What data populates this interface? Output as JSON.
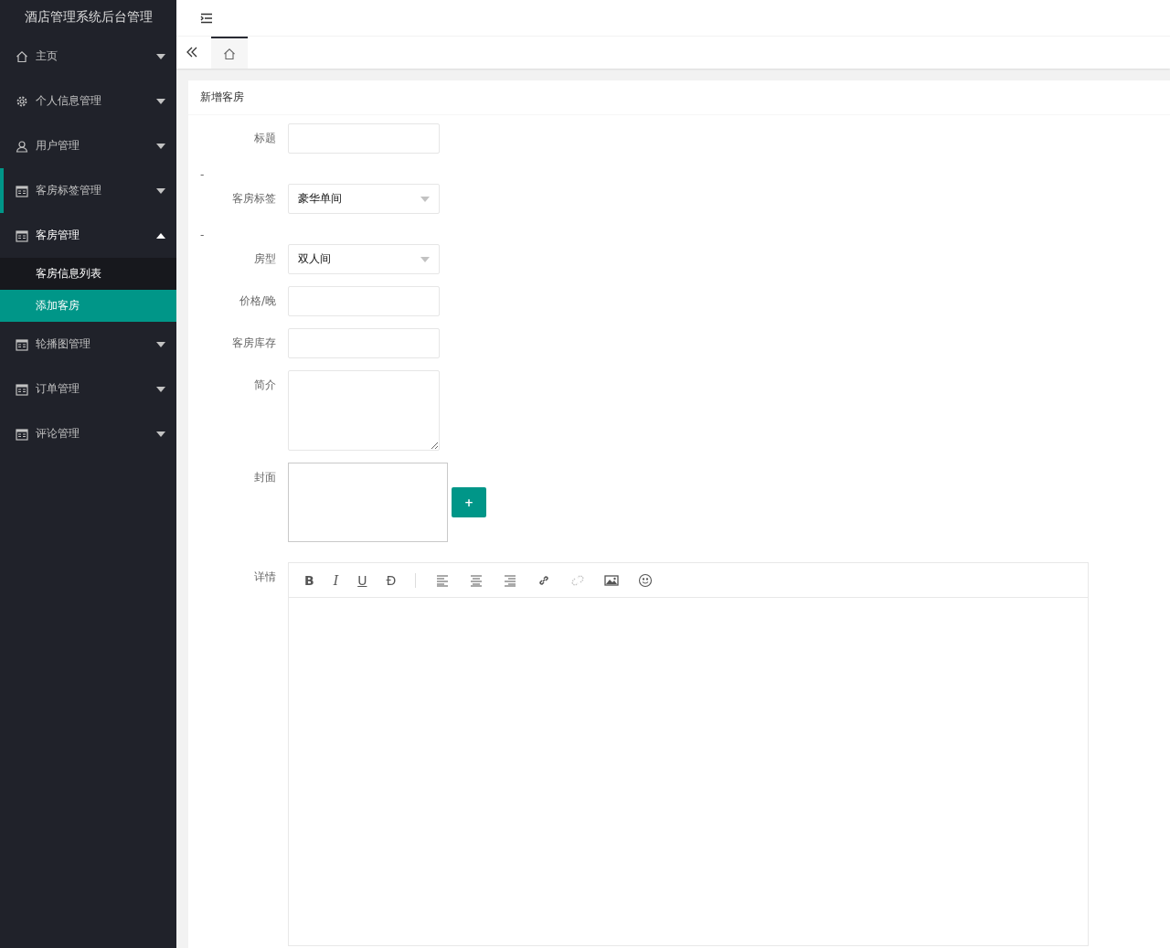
{
  "sidebar": {
    "title": "酒店管理系统后台管理",
    "items": [
      {
        "label": "主页",
        "kind": "home",
        "expanded": false,
        "highlighted": false
      },
      {
        "label": "个人信息管理",
        "kind": "gear",
        "expanded": false,
        "highlighted": false
      },
      {
        "label": "用户管理",
        "kind": "user",
        "expanded": false,
        "highlighted": false
      },
      {
        "label": "客房标签管理",
        "kind": "calendar",
        "expanded": false,
        "highlighted": true
      },
      {
        "label": "客房管理",
        "kind": "calendar",
        "expanded": true,
        "highlighted": false,
        "children": [
          {
            "label": "客房信息列表",
            "selected": false
          },
          {
            "label": "添加客房",
            "selected": true
          }
        ]
      },
      {
        "label": "轮播图管理",
        "kind": "calendar",
        "expanded": false,
        "highlighted": false
      },
      {
        "label": "订单管理",
        "kind": "calendar",
        "expanded": false,
        "highlighted": false
      },
      {
        "label": "评论管理",
        "kind": "calendar",
        "expanded": false,
        "highlighted": false
      }
    ]
  },
  "tabs": [
    {
      "kind": "home",
      "selected": true
    }
  ],
  "card": {
    "title": "新增客房",
    "fields": [
      {
        "kind": "input",
        "label": "标题"
      },
      {
        "kind": "dash",
        "label": "-"
      },
      {
        "kind": "select",
        "label": "客房标签",
        "value": "豪华单间"
      },
      {
        "kind": "dash",
        "label": "-"
      },
      {
        "kind": "select",
        "label": "房型",
        "value": "双人间"
      },
      {
        "kind": "input",
        "label": "价格/晚"
      },
      {
        "kind": "input",
        "label": "客房库存"
      },
      {
        "kind": "textarea",
        "label": "简介"
      },
      {
        "kind": "upload",
        "label": "封面",
        "button": "+"
      },
      {
        "kind": "editor",
        "label": "详情",
        "tools": [
          {
            "kind": "bold",
            "text": "B",
            "disabled": false
          },
          {
            "kind": "italic",
            "text": "I",
            "disabled": false
          },
          {
            "kind": "underline",
            "text": "U",
            "disabled": false
          },
          {
            "kind": "strike",
            "text": "Đ",
            "disabled": false
          },
          {
            "kind": "separator"
          },
          {
            "kind": "align-left",
            "disabled": false
          },
          {
            "kind": "align-center",
            "disabled": false
          },
          {
            "kind": "align-right",
            "disabled": false
          },
          {
            "kind": "link",
            "disabled": false
          },
          {
            "kind": "unlink",
            "disabled": true
          },
          {
            "kind": "image",
            "disabled": false
          },
          {
            "kind": "emoji",
            "disabled": false
          }
        ]
      }
    ]
  }
}
